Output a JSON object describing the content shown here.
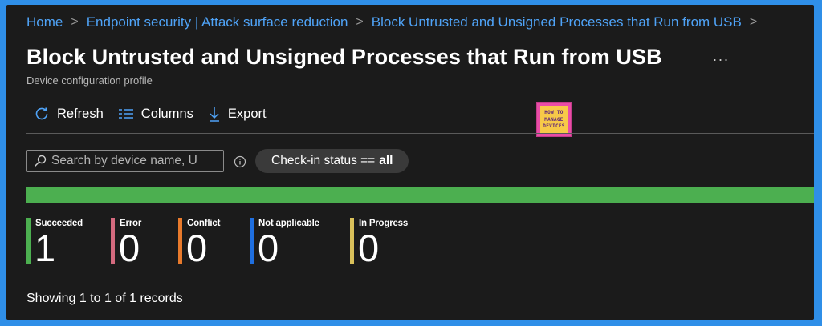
{
  "breadcrumb": {
    "items": [
      "Home",
      "Endpoint security | Attack surface reduction",
      "Block Untrusted and Unsigned Processes that Run from USB"
    ],
    "separator": ">"
  },
  "page": {
    "title": "Block Untrusted and Unsigned Processes that Run from USB",
    "more_label": "...",
    "subtitle": "Device configuration profile"
  },
  "toolbar": {
    "refresh_label": "Refresh",
    "columns_label": "Columns",
    "export_label": "Export",
    "accent_color": "#4fa3f7"
  },
  "logo": {
    "line1": "HOW TO",
    "line2": "MANAGE",
    "line3": "DEVICES"
  },
  "search": {
    "placeholder": "Search by device name, U"
  },
  "filter": {
    "prefix": "Check-in status ==",
    "value": "all"
  },
  "status_bar": {
    "color": "#4caf50",
    "succeeded_fraction": 1.0
  },
  "stats": [
    {
      "label": "Succeeded",
      "value": "1",
      "color": "#4caf50"
    },
    {
      "label": "Error",
      "value": "0",
      "color": "#d46a7e"
    },
    {
      "label": "Conflict",
      "value": "0",
      "color": "#e87a2c"
    },
    {
      "label": "Not applicable",
      "value": "0",
      "color": "#1f6fe0"
    },
    {
      "label": "In Progress",
      "value": "0",
      "color": "#d9c05a"
    }
  ],
  "records_text": "Showing 1 to 1 of 1 records"
}
